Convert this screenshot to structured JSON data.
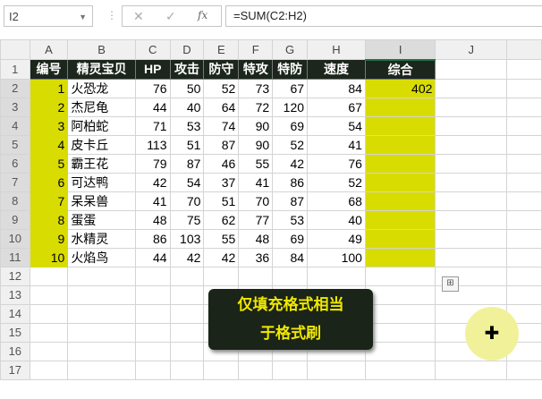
{
  "name_box": "I2",
  "formula_bar": {
    "cancel_icon": "✕",
    "enter_icon": "✓",
    "fx_icon": "fx",
    "formula": "=SUM(C2:H2)"
  },
  "columns": [
    "A",
    "B",
    "C",
    "D",
    "E",
    "F",
    "G",
    "H",
    "I",
    "J"
  ],
  "rows": [
    "1",
    "2",
    "3",
    "4",
    "5",
    "6",
    "7",
    "8",
    "9",
    "10",
    "11",
    "12",
    "13",
    "14",
    "15",
    "16",
    "17"
  ],
  "headers": [
    "编号",
    "精灵宝贝",
    "HP",
    "攻击",
    "防守",
    "特攻",
    "特防",
    "速度",
    "综合"
  ],
  "data": [
    [
      "1",
      "火恐龙",
      "76",
      "50",
      "52",
      "73",
      "67",
      "84",
      "402"
    ],
    [
      "2",
      "杰尼龟",
      "44",
      "40",
      "64",
      "72",
      "120",
      "67",
      ""
    ],
    [
      "3",
      "阿柏蛇",
      "71",
      "53",
      "74",
      "90",
      "69",
      "54",
      ""
    ],
    [
      "4",
      "皮卡丘",
      "113",
      "51",
      "87",
      "90",
      "52",
      "41",
      ""
    ],
    [
      "5",
      "霸王花",
      "79",
      "87",
      "46",
      "55",
      "42",
      "76",
      ""
    ],
    [
      "6",
      "可达鸭",
      "42",
      "54",
      "37",
      "41",
      "86",
      "52",
      ""
    ],
    [
      "7",
      "呆呆兽",
      "41",
      "70",
      "51",
      "70",
      "87",
      "68",
      ""
    ],
    [
      "8",
      "蛋蛋",
      "48",
      "75",
      "62",
      "77",
      "53",
      "40",
      ""
    ],
    [
      "9",
      "水精灵",
      "86",
      "103",
      "55",
      "48",
      "69",
      "49",
      ""
    ],
    [
      "10",
      "火焰鸟",
      "44",
      "42",
      "42",
      "36",
      "84",
      "100",
      ""
    ]
  ],
  "callout": {
    "line1": "仅填充格式相当",
    "line2": "于格式刷"
  },
  "colors": {
    "highlight": "#d9dc00",
    "header_bg": "#1c261c",
    "callout_text": "#f0e800"
  }
}
